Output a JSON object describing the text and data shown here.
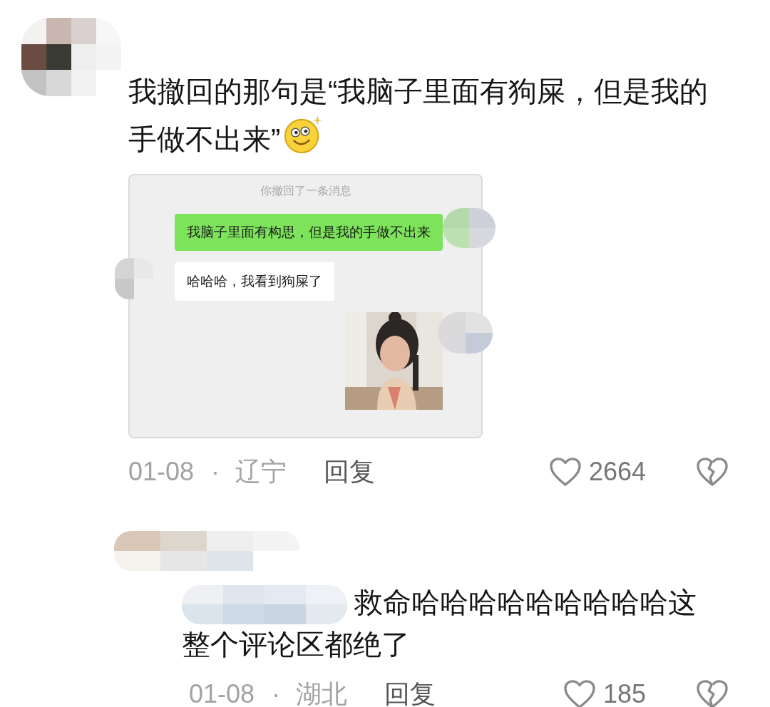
{
  "comments": [
    {
      "text": "我撤回的那句是“我脑子里面有狗屎，但是我的手做不出来”",
      "chat_screenshot": {
        "notice": "你撤回了一条消息",
        "messages": [
          {
            "kind": "sent",
            "text": "我脑子里面有构思，但是我的手做不出来"
          },
          {
            "kind": "received",
            "text": "哈哈哈，我看到狗屎了"
          },
          {
            "kind": "sticker"
          }
        ]
      },
      "date": "01-08",
      "separator": "·",
      "region": "辽宁",
      "reply": "回复",
      "likes": "2664"
    },
    {
      "text": "救命哈哈哈哈哈哈哈哈哈这整个评论区都绝了",
      "date": "01-08",
      "separator": "·",
      "region": "湖北",
      "reply": "回复",
      "likes": "185"
    }
  ]
}
